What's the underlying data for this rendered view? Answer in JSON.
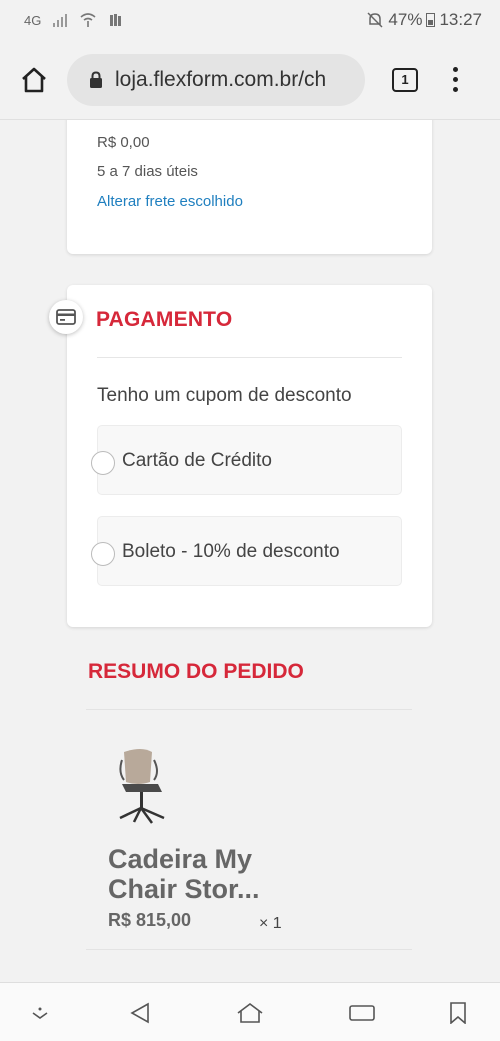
{
  "status_bar": {
    "network": "4G",
    "battery": "47%",
    "time": "13:27"
  },
  "browser": {
    "url": "loja.flexform.com.br/ch",
    "tab_count": "1"
  },
  "shipping": {
    "price": "R$ 0,00",
    "delivery_time": "5 a 7 dias úteis",
    "change_link": "Alterar frete escolhido"
  },
  "payment": {
    "title": "PAGAMENTO",
    "coupon_text": "Tenho um cupom de desconto",
    "options": [
      {
        "label": "Cartão de Crédito",
        "selected": false
      },
      {
        "label": "Boleto - 10% de desconto",
        "selected": false
      }
    ]
  },
  "summary": {
    "title": "RESUMO DO PEDIDO",
    "product": {
      "name": "Cadeira My Chair Stor...",
      "price": "R$ 815,00",
      "quantity": "× 1"
    }
  },
  "colors": {
    "accent_red": "#d6283a",
    "link_blue": "#1f7fbf"
  },
  "icons": {
    "home": "home-icon",
    "lock": "lock-icon",
    "payment": "credit-card-icon",
    "menu": "more-vert-icon"
  }
}
